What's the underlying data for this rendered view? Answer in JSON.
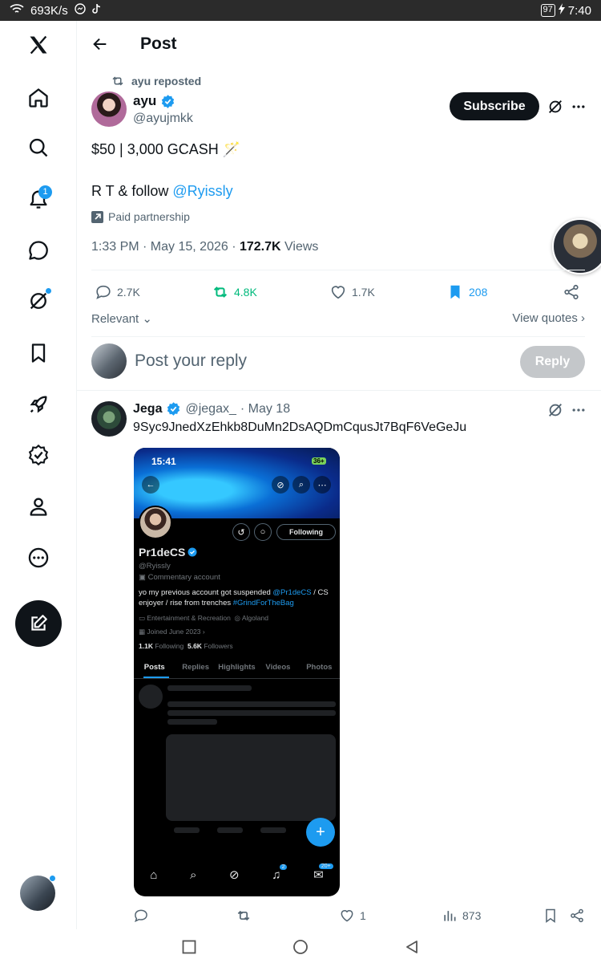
{
  "status_bar": {
    "speed": "693K/s",
    "battery": "97",
    "time": "7:40"
  },
  "header": {
    "title": "Post"
  },
  "rail": {
    "notifications_badge": "1"
  },
  "post": {
    "repost_label": "ayu reposted",
    "author_name": "ayu",
    "author_handle": "@ayujmkk",
    "subscribe_label": "Subscribe",
    "text_line1": "$50 | 3,000 GCASH 🪄",
    "text_prefix": "R T & follow ",
    "mention": "@Ryissly",
    "paid_label": "Paid partnership",
    "timestamp": "1:33 PM · May 15, 2026 · ",
    "views_count": "172.7K",
    "views_label": " Views",
    "replies": "2.7K",
    "reposts": "4.8K",
    "likes": "1.7K",
    "bookmarks": "208"
  },
  "sort": {
    "relevant": "Relevant",
    "view_quotes": "View quotes"
  },
  "composer": {
    "placeholder": "Post your reply",
    "reply_label": "Reply"
  },
  "reply": {
    "name": "Jega",
    "handle": "@jegax_",
    "date": "· May 18",
    "text": "9Syc9JnedXzEhkb8DuMn2DsAQDmCqusJt7BqF6VeGeJu",
    "likes": "1",
    "views": "873"
  },
  "embed": {
    "time": "15:41",
    "battery": "36+",
    "following": "Following",
    "name": "Pr1deCS",
    "handle": "@Ryissly",
    "commentary": "Commentary account",
    "bio1_prefix": "yo my previous account got suspended ",
    "bio1_mention": "@Pr1deCS",
    "bio1_suffix": " / CS",
    "bio2_prefix": "enjoyer / rise from trenches ",
    "bio2_tag": "#GrindForTheBag",
    "category": "Entertainment & Recreation",
    "location": "Algoland",
    "joined": "Joined June 2023",
    "following_count": "1.1K",
    "following_label": " Following",
    "followers_count": "5.6K",
    "followers_label": " Followers",
    "tabs": [
      "Posts",
      "Replies",
      "Highlights",
      "Videos",
      "Photos"
    ],
    "nav_badge_notif": "2",
    "nav_badge_msg": "20+"
  },
  "colors": {
    "accent": "#1d9bf0",
    "repost_green": "#00ba7c",
    "text": "#0f1419",
    "muted": "#536471"
  }
}
